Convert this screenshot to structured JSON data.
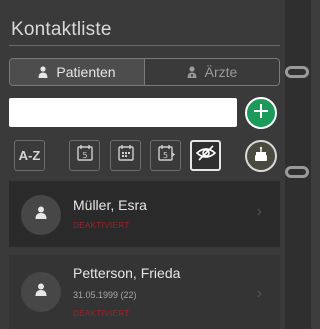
{
  "header": {
    "title": "Kontaktliste"
  },
  "tabs": [
    {
      "label": "Patienten",
      "icon": "person-icon",
      "active": true
    },
    {
      "label": "Ärzte",
      "icon": "doctor-icon",
      "active": false
    }
  ],
  "search": {
    "value": "",
    "placeholder": ""
  },
  "toolbar": {
    "az_label": "A-Z",
    "buttons": [
      "sort-az",
      "calendar-5-icon",
      "calendar-grid-icon",
      "calendar-5-next-icon",
      "hide-icon"
    ],
    "add_icon": "plus-icon",
    "birthday_icon": "cake-icon"
  },
  "contacts": [
    {
      "name": "Müller, Esra",
      "dob": "",
      "status": "DEAKTIVIERT"
    },
    {
      "name": "Petterson, Frieda",
      "dob": "31.05.1999 (22)",
      "status": "DEAKTIVIERT"
    }
  ],
  "colors": {
    "background": "#3a3a3a",
    "accent_green": "#1b9a5a",
    "status_red": "#a2202a"
  }
}
